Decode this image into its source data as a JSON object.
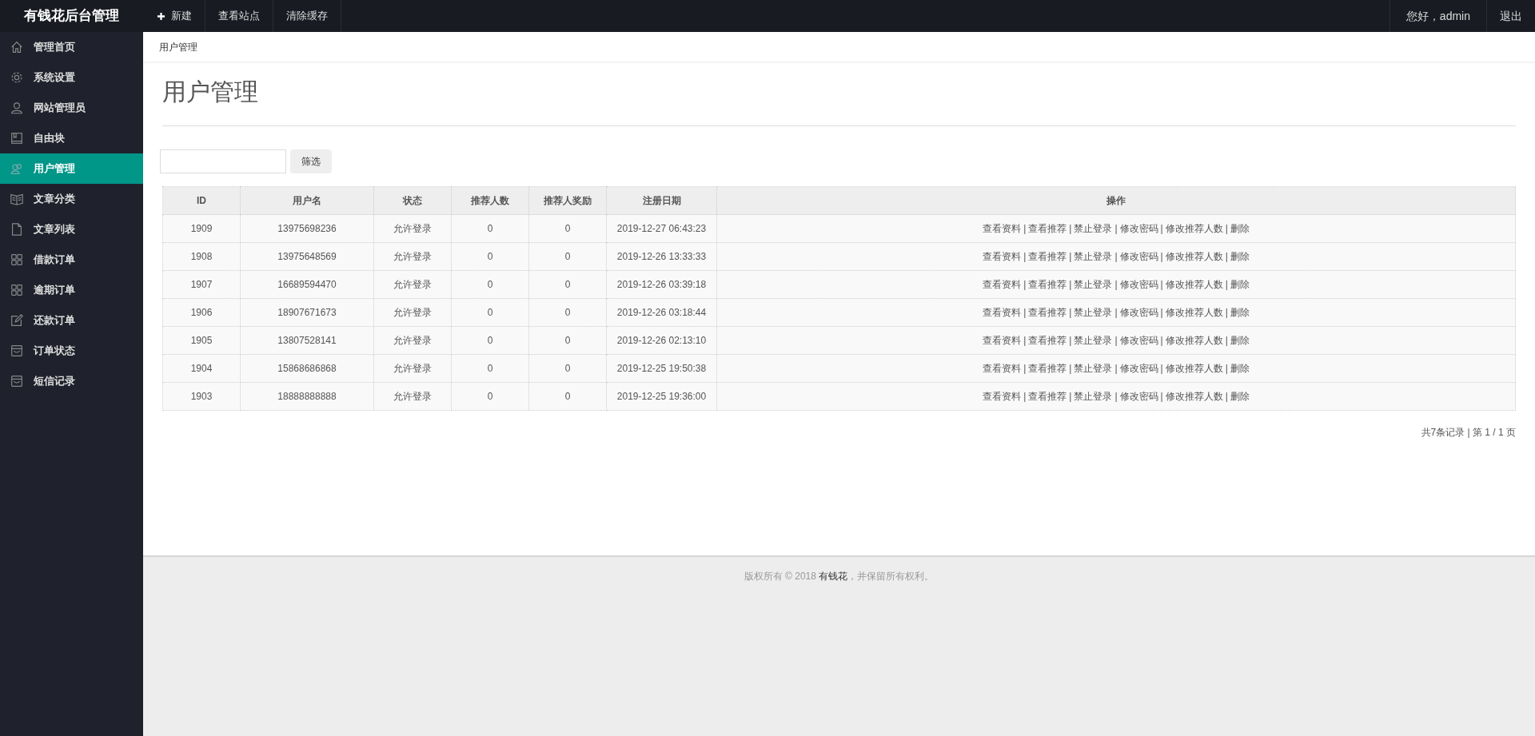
{
  "brand": "有钱花后台管理",
  "topnav": [
    {
      "label": "新建",
      "kind": "plus"
    },
    {
      "label": "查看站点"
    },
    {
      "label": "清除缓存"
    }
  ],
  "user": {
    "greeting": "您好，admin",
    "logout": "退出"
  },
  "sidebar": {
    "items": [
      {
        "label": "管理首页",
        "kind": "home",
        "selected": false
      },
      {
        "label": "系统设置",
        "kind": "gear",
        "selected": false
      },
      {
        "label": "网站管理员",
        "kind": "user",
        "selected": false
      },
      {
        "label": "自由块",
        "kind": "book",
        "selected": false
      },
      {
        "label": "用户管理",
        "kind": "users",
        "selected": true
      },
      {
        "label": "文章分类",
        "kind": "openbook",
        "selected": false
      },
      {
        "label": "文章列表",
        "kind": "file",
        "selected": false
      },
      {
        "label": "借款订单",
        "kind": "grid",
        "selected": false
      },
      {
        "label": "逾期订单",
        "kind": "grid",
        "selected": false
      },
      {
        "label": "还款订单",
        "kind": "edit",
        "selected": false
      },
      {
        "label": "订单状态",
        "kind": "inbox",
        "selected": false
      },
      {
        "label": "短信记录",
        "kind": "inbox",
        "selected": false
      }
    ]
  },
  "breadcrumb": "用户管理",
  "page_title": "用户管理",
  "filter": {
    "button": "筛选"
  },
  "table": {
    "columns": [
      "ID",
      "用户名",
      "状态",
      "推荐人数",
      "推荐人奖励",
      "注册日期",
      "操作"
    ],
    "separator": "|",
    "rows": [
      {
        "cells": [
          "1909",
          "13975698236",
          "允许登录",
          "0",
          "0",
          "2019-12-27 06:43:23"
        ],
        "actions": [
          "查看资料",
          "查看推荐",
          "禁止登录",
          "修改密码",
          "修改推荐人数",
          "删除"
        ]
      },
      {
        "cells": [
          "1908",
          "13975648569",
          "允许登录",
          "0",
          "0",
          "2019-12-26 13:33:33"
        ],
        "actions": [
          "查看资料",
          "查看推荐",
          "禁止登录",
          "修改密码",
          "修改推荐人数",
          "删除"
        ]
      },
      {
        "cells": [
          "1907",
          "16689594470",
          "允许登录",
          "0",
          "0",
          "2019-12-26 03:39:18"
        ],
        "actions": [
          "查看资料",
          "查看推荐",
          "禁止登录",
          "修改密码",
          "修改推荐人数",
          "删除"
        ]
      },
      {
        "cells": [
          "1906",
          "18907671673",
          "允许登录",
          "0",
          "0",
          "2019-12-26 03:18:44"
        ],
        "actions": [
          "查看资料",
          "查看推荐",
          "禁止登录",
          "修改密码",
          "修改推荐人数",
          "删除"
        ]
      },
      {
        "cells": [
          "1905",
          "13807528141",
          "允许登录",
          "0",
          "0",
          "2019-12-26 02:13:10"
        ],
        "actions": [
          "查看资料",
          "查看推荐",
          "禁止登录",
          "修改密码",
          "修改推荐人数",
          "删除"
        ]
      },
      {
        "cells": [
          "1904",
          "15868686868",
          "允许登录",
          "0",
          "0",
          "2019-12-25 19:50:38"
        ],
        "actions": [
          "查看资料",
          "查看推荐",
          "禁止登录",
          "修改密码",
          "修改推荐人数",
          "删除"
        ]
      },
      {
        "cells": [
          "1903",
          "18888888888",
          "允许登录",
          "0",
          "0",
          "2019-12-25 19:36:00"
        ],
        "actions": [
          "查看资料",
          "查看推荐",
          "禁止登录",
          "修改密码",
          "修改推荐人数",
          "删除"
        ]
      }
    ]
  },
  "pagination": "共7条记录 | 第 1 / 1 页",
  "footer": {
    "before": "版权所有 © 2018 ",
    "link": "有钱花",
    "after": "，并保留所有权利。"
  }
}
